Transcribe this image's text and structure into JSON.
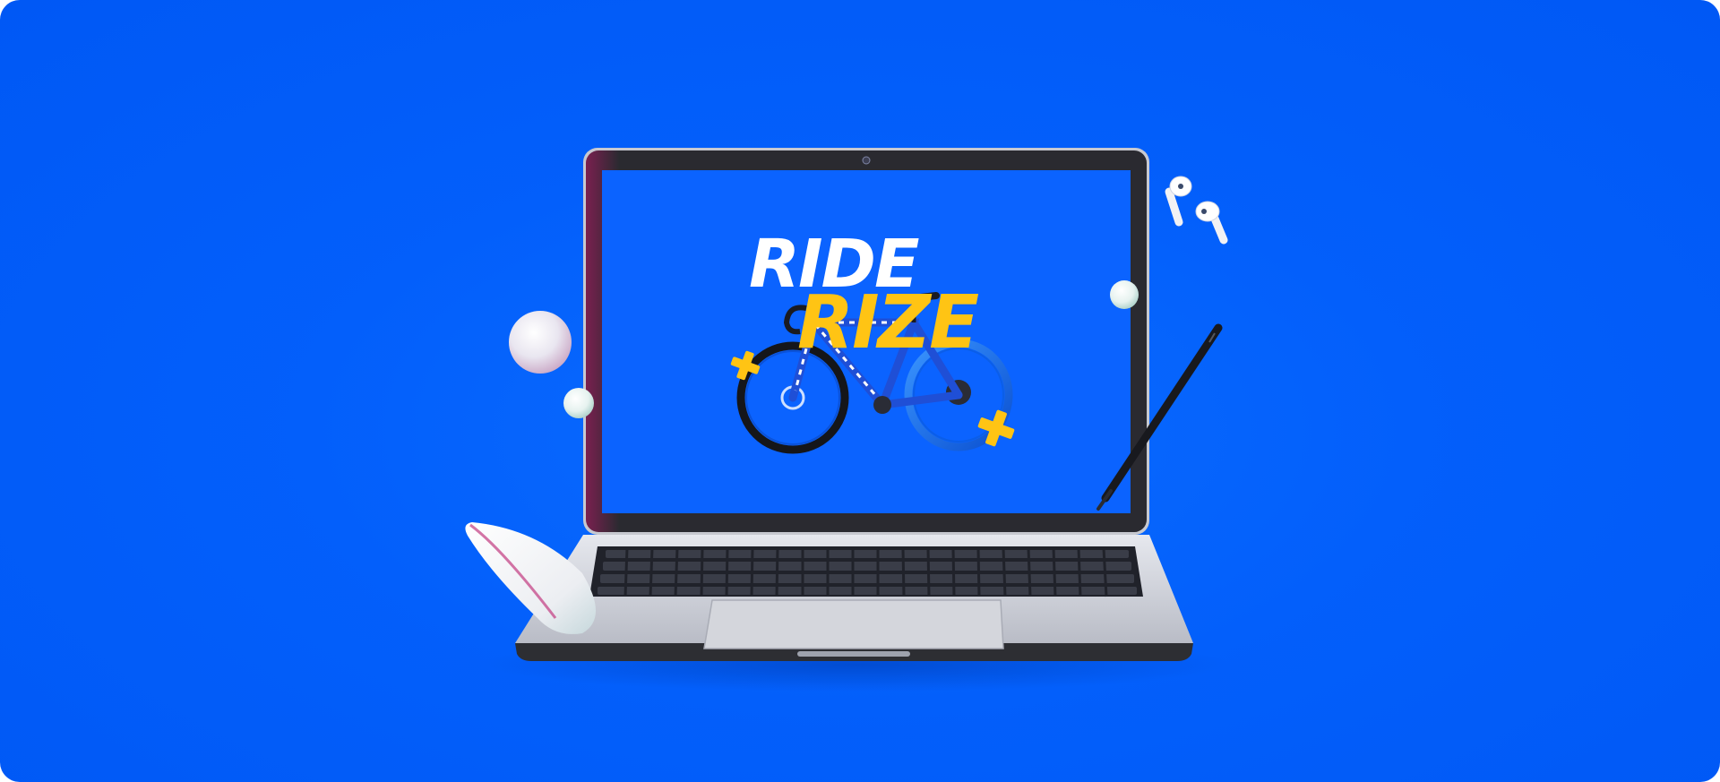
{
  "screen": {
    "headline": "RIDE",
    "subheadline": "RIZE"
  },
  "colors": {
    "background": "#035ffb",
    "headline": "#ffffff",
    "accent": "#ffc414"
  },
  "objects": [
    "laptop",
    "bicycle",
    "mouse",
    "stylus-pen",
    "earbuds",
    "pearl-spheres"
  ]
}
